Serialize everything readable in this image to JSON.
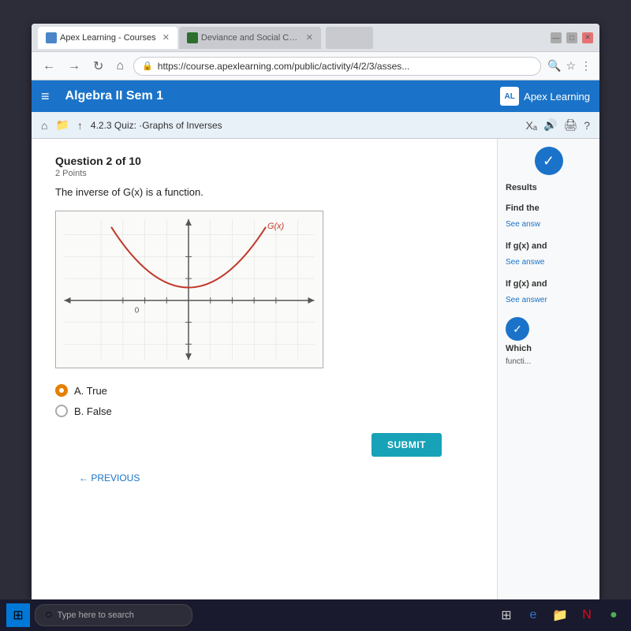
{
  "browser": {
    "tabs": [
      {
        "label": "Apex Learning - Courses",
        "url": "apex",
        "active": true
      },
      {
        "label": "Deviance and Social Con...",
        "url": "deviance",
        "active": false
      }
    ],
    "address": "https://course.apexlearning.com/public/activity/4/2/3/asses...",
    "window_controls": [
      "minimize",
      "maximize",
      "close"
    ]
  },
  "apex": {
    "toolbar_title": "Algebra II Sem 1",
    "logo_text": "Apex Learning",
    "quiz_title": "4.2.3  Quiz: ·Graphs of Inverses"
  },
  "question": {
    "number": "Question 2 of 10",
    "points": "2 Points",
    "text": "The inverse of G(x) is a function.",
    "graph_label": "G(x)",
    "answers": [
      {
        "id": "A",
        "label": "A.  True",
        "selected": true
      },
      {
        "id": "B",
        "label": "B.  False",
        "selected": false
      }
    ],
    "submit_label": "SUBMIT"
  },
  "sidebar": {
    "sections": [
      {
        "title": "Results",
        "text": "",
        "link": ""
      },
      {
        "title": "Find the",
        "text": "",
        "link": "See answ"
      },
      {
        "title": "If g(x) and",
        "text": "",
        "link": "See answe"
      },
      {
        "title": "If g(x) and",
        "text": "",
        "link": "See answer"
      },
      {
        "title": "Which",
        "text": "functi...",
        "link": ""
      }
    ]
  },
  "bottom_nav": {
    "prev_label": "← PREVIOUS"
  },
  "taskbar": {
    "search_placeholder": "Type here to search"
  }
}
